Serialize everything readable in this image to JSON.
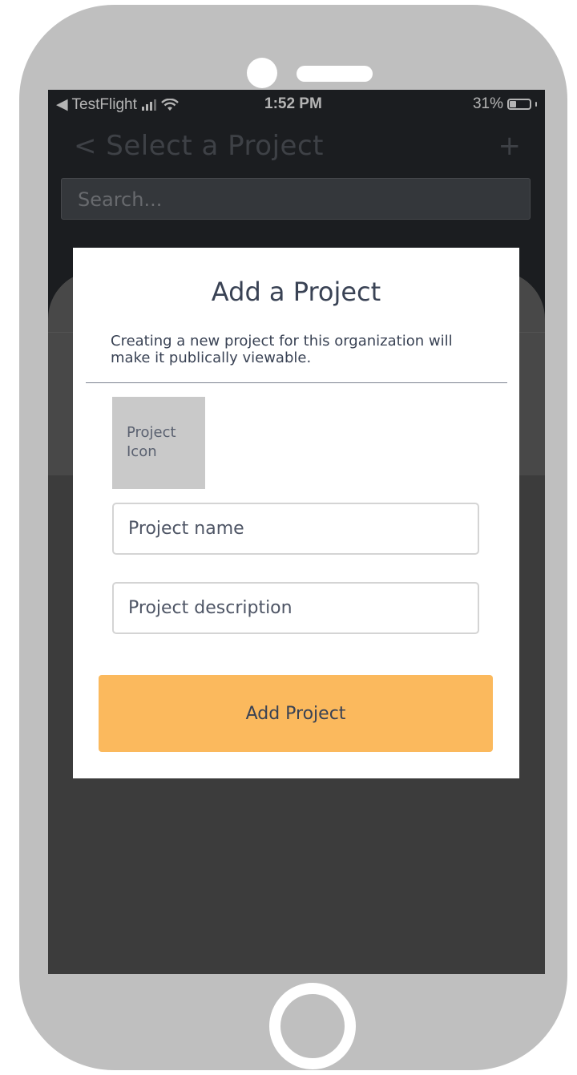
{
  "status_bar": {
    "back_label": "◀ TestFlight",
    "time": "1:52 PM",
    "battery_text": "31%",
    "battery_level": 0.31
  },
  "header": {
    "title": "< Select a Project",
    "add_label": "+"
  },
  "search": {
    "placeholder": "Search..."
  },
  "modal": {
    "title": "Add a Project",
    "description": "Creating a new project for this organization will make it publically viewable.",
    "icon_label": "Project Icon",
    "name_placeholder": "Project name",
    "description_placeholder": "Project description",
    "submit_label": "Add Project"
  },
  "colors": {
    "accent": "#fbb95d",
    "header_bg": "#15181d",
    "text_primary": "#394254",
    "frame": "#bfbfbf"
  }
}
